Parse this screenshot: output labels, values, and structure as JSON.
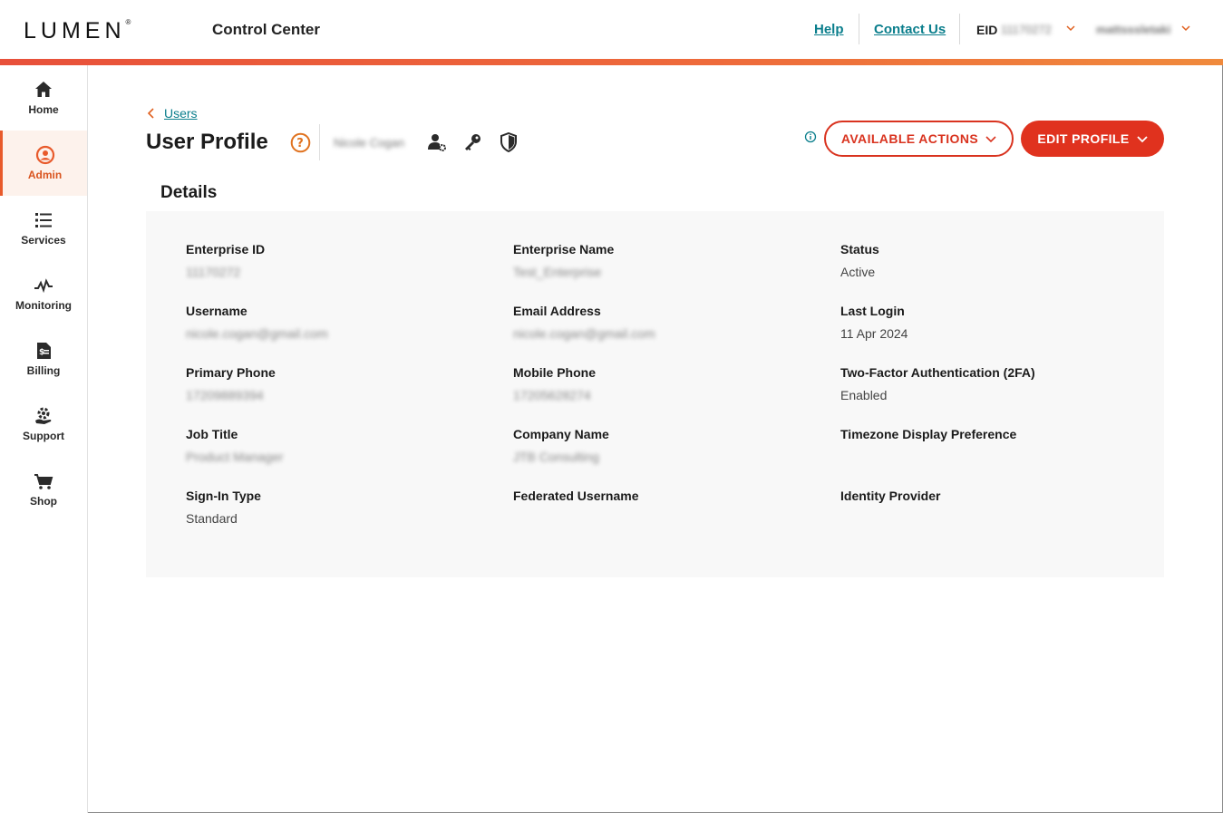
{
  "header": {
    "logo": "LUMEN",
    "app_title": "Control Center",
    "help_label": "Help",
    "contact_label": "Contact Us",
    "eid_label": "EID",
    "eid_value": "11170272",
    "user_value": "mattsssletaki"
  },
  "sidebar": {
    "items": [
      {
        "label": "Home",
        "icon": "home-icon"
      },
      {
        "label": "Admin",
        "icon": "user-circle-icon",
        "active": true
      },
      {
        "label": "Services",
        "icon": "list-icon"
      },
      {
        "label": "Monitoring",
        "icon": "pulse-icon"
      },
      {
        "label": "Billing",
        "icon": "invoice-icon"
      },
      {
        "label": "Support",
        "icon": "support-icon"
      },
      {
        "label": "Shop",
        "icon": "cart-icon"
      }
    ]
  },
  "main": {
    "back_label": "Users",
    "title": "User Profile",
    "profile_name": "Nicole Cogan",
    "available_actions_label": "AVAILABLE ACTIONS",
    "edit_profile_label": "EDIT PROFILE",
    "details_title": "Details",
    "fields": [
      {
        "label": "Enterprise ID",
        "value": "11170272",
        "blurred": true
      },
      {
        "label": "Enterprise Name",
        "value": "Test_Enterprise",
        "blurred": true
      },
      {
        "label": "Status",
        "value": "Active",
        "blurred": false
      },
      {
        "label": "Username",
        "value": "nicole.cogan@gmail.com",
        "blurred": true
      },
      {
        "label": "Email Address",
        "value": "nicole.cogan@gmail.com",
        "blurred": true
      },
      {
        "label": "Last Login",
        "value": "11 Apr 2024",
        "blurred": false
      },
      {
        "label": "Primary Phone",
        "value": "17209889394",
        "blurred": true
      },
      {
        "label": "Mobile Phone",
        "value": "17205628274",
        "blurred": true
      },
      {
        "label": "Two-Factor Authentication (2FA)",
        "value": "Enabled",
        "blurred": false
      },
      {
        "label": "Job Title",
        "value": "Product Manager",
        "blurred": true
      },
      {
        "label": "Company Name",
        "value": "JTB Consulting",
        "blurred": true
      },
      {
        "label": "Timezone Display Preference",
        "value": "",
        "blurred": false
      },
      {
        "label": "Sign-In Type",
        "value": "Standard",
        "blurred": false
      },
      {
        "label": "Federated Username",
        "value": "",
        "blurred": false
      },
      {
        "label": "Identity Provider",
        "value": "",
        "blurred": false
      }
    ]
  },
  "colors": {
    "accent": "#e0321e",
    "link": "#0a7e8c",
    "active_nav": "#d9541f"
  }
}
